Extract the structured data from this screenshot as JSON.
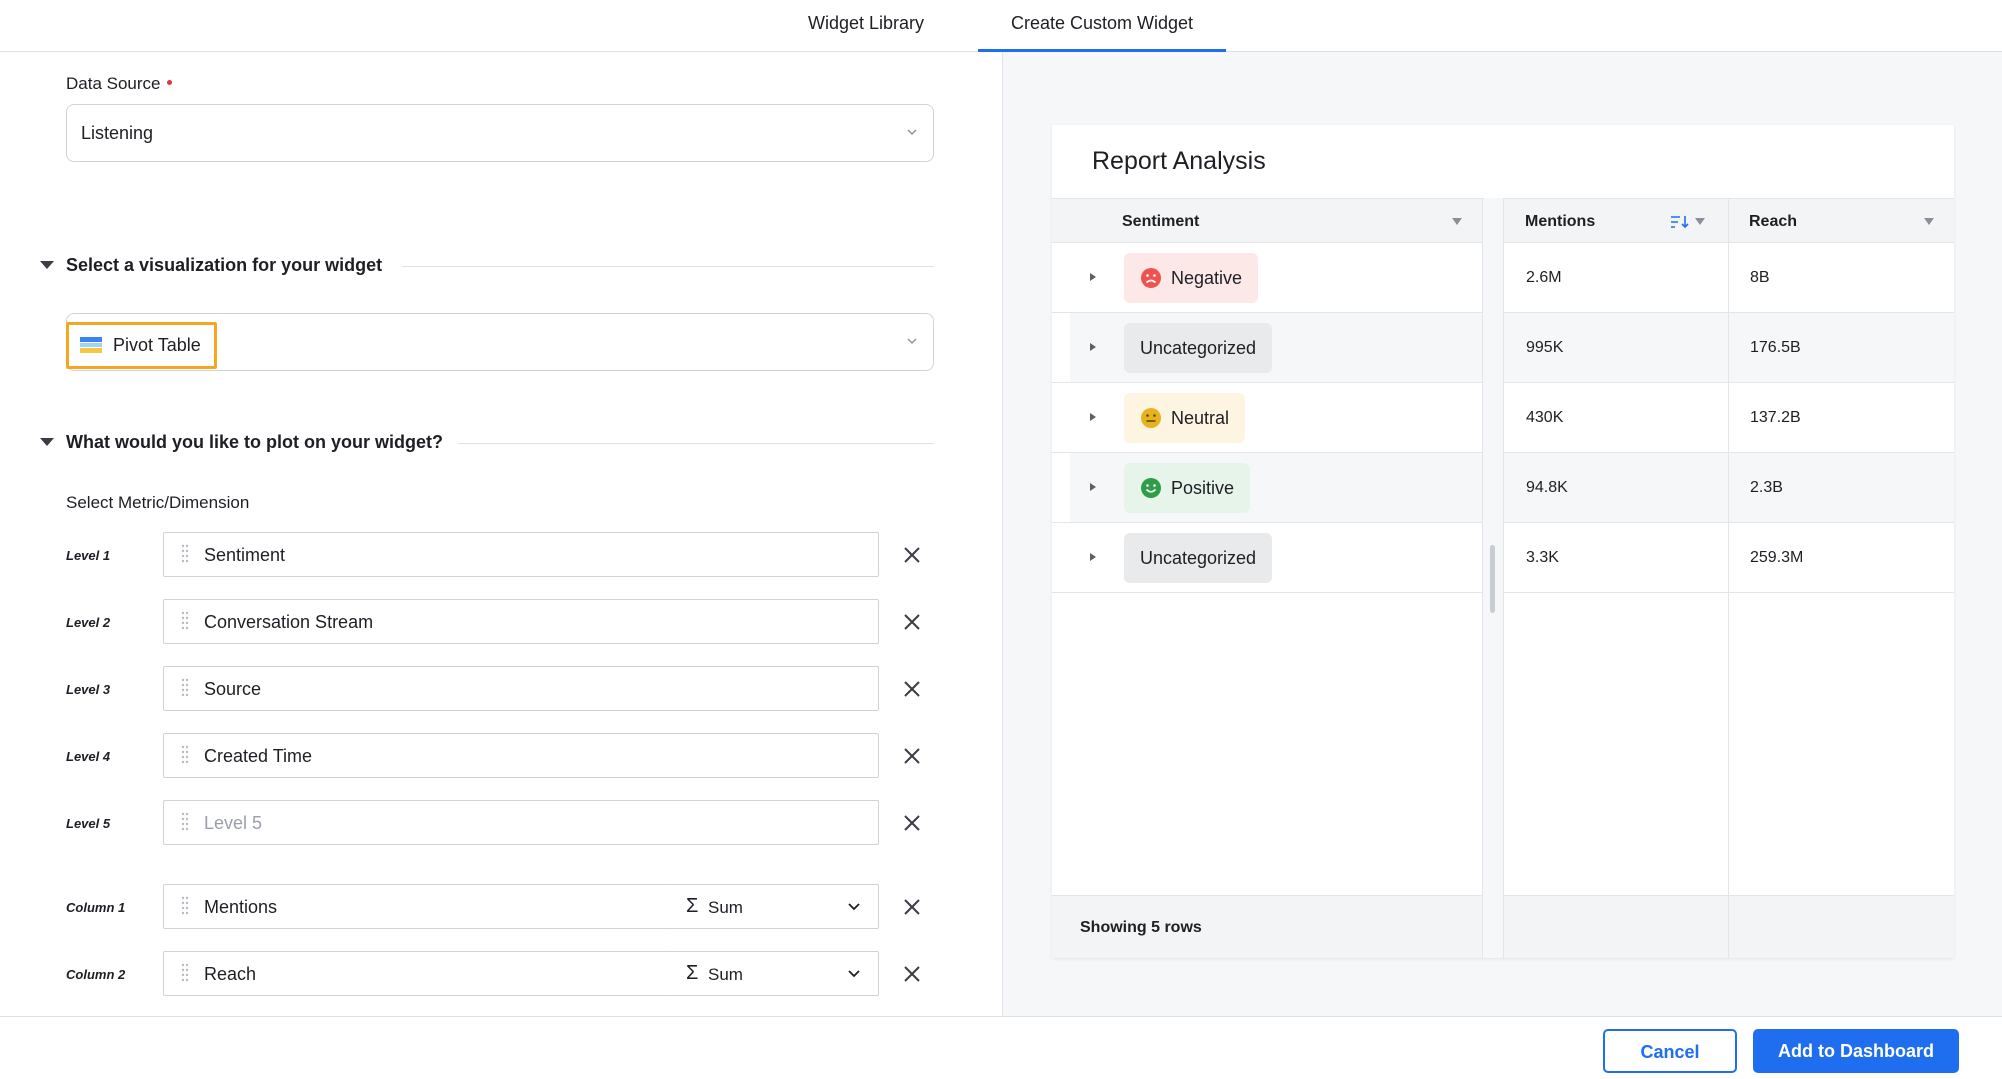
{
  "tabs": [
    {
      "label": "Widget Library"
    },
    {
      "label": "Create Custom Widget",
      "active": true
    }
  ],
  "form": {
    "data_source_label": "Data Source",
    "data_source_value": "Listening",
    "viz_section_title": "Select a visualization for your widget",
    "viz_value": "Pivot Table",
    "plot_section_title": "What would you like to plot on your widget?",
    "metric_dimension_label": "Select Metric/Dimension",
    "levels": [
      {
        "label": "Level 1",
        "value": "Sentiment",
        "placeholder": false
      },
      {
        "label": "Level 2",
        "value": "Conversation Stream",
        "placeholder": false
      },
      {
        "label": "Level 3",
        "value": "Source",
        "placeholder": false
      },
      {
        "label": "Level 4",
        "value": "Created Time",
        "placeholder": false
      },
      {
        "label": "Level 5",
        "value": "Level 5",
        "placeholder": true
      }
    ],
    "columns": [
      {
        "label": "Column 1",
        "value": "Mentions",
        "aggregation": "Sum"
      },
      {
        "label": "Column 2",
        "value": "Reach",
        "aggregation": "Sum"
      }
    ]
  },
  "report": {
    "title": "Report Analysis",
    "headers": {
      "sentiment": "Sentiment",
      "mentions": "Mentions",
      "reach": "Reach"
    },
    "rows": [
      {
        "sentiment": "Negative",
        "mentions": "2.6M",
        "reach": "8B",
        "pill_color": "#fde8e8",
        "emoji": "sad"
      },
      {
        "sentiment": "Uncategorized",
        "mentions": "995K",
        "reach": "176.5B",
        "pill_color": "#e9eaec",
        "emoji": "none"
      },
      {
        "sentiment": "Neutral",
        "mentions": "430K",
        "reach": "137.2B",
        "pill_color": "#fdf5e2",
        "emoji": "neutral"
      },
      {
        "sentiment": "Positive",
        "mentions": "94.8K",
        "reach": "2.3B",
        "pill_color": "#e6f4ea",
        "emoji": "happy"
      },
      {
        "sentiment": "Uncategorized",
        "mentions": "3.3K",
        "reach": "259.3M",
        "pill_color": "#e9eaec",
        "emoji": "none"
      }
    ],
    "footer": "Showing 5 rows"
  },
  "actions": {
    "cancel": "Cancel",
    "add": "Add to Dashboard"
  },
  "colors": {
    "accent": "#1f6ef0",
    "highlight": "#f5a623",
    "negative": "#ef5350",
    "neutral": "#e8b21c",
    "positive": "#2e9e49"
  }
}
